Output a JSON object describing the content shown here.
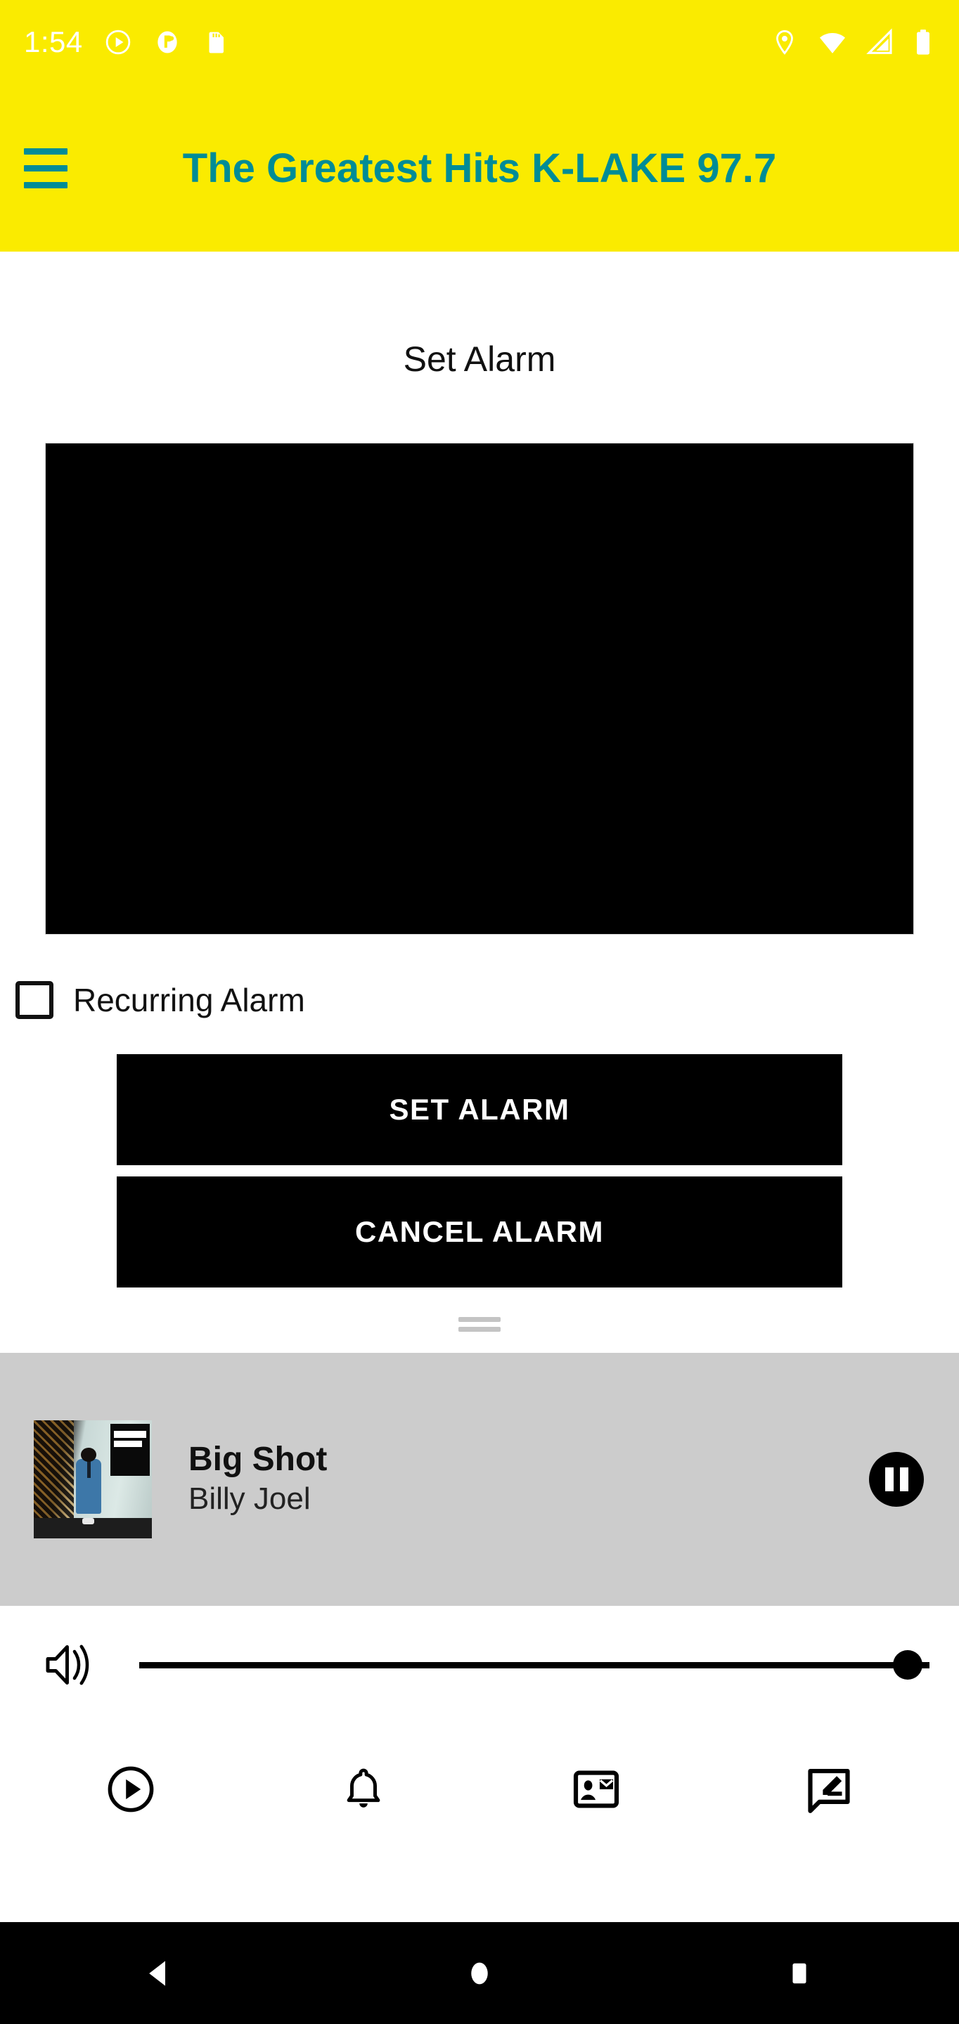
{
  "status_bar": {
    "clock": "1:54",
    "left_icons": [
      "play-circle-notification-icon",
      "app-notification-icon",
      "sd-card-icon"
    ],
    "right_icons": [
      "location-pin-icon",
      "wifi-icon",
      "cellular-signal-icon",
      "battery-icon"
    ]
  },
  "app_bar": {
    "menu_icon": "hamburger-menu-icon",
    "title": "The Greatest Hits K-LAKE 97.7",
    "background_color": "#FAEB00",
    "title_color": "#008C96"
  },
  "main": {
    "screen_title": "Set Alarm",
    "time_picker": {
      "name": "time-picker",
      "state": "blank",
      "background_color": "#000000"
    },
    "recurring": {
      "label": "Recurring Alarm",
      "checked": false
    },
    "buttons": [
      {
        "label": "SET ALARM",
        "name": "set-alarm-button"
      },
      {
        "label": "CANCEL ALARM",
        "name": "cancel-alarm-button"
      }
    ]
  },
  "now_playing": {
    "drag_handle": "drag-handle",
    "album_art_alt": "Billy Joel 52nd Street album cover",
    "title": "Big Shot",
    "artist": "Billy Joel",
    "transport_button": "pause-icon",
    "playing": true,
    "background_color": "#CCCCCC"
  },
  "volume": {
    "icon": "volume-up-icon",
    "level_percent": 100
  },
  "bottom_nav": [
    {
      "name": "tab-play",
      "icon": "play-circle-outline-icon"
    },
    {
      "name": "tab-alarm",
      "icon": "bell-icon"
    },
    {
      "name": "tab-contact",
      "icon": "contact-mail-icon"
    },
    {
      "name": "tab-feedback",
      "icon": "rate-review-icon"
    }
  ],
  "android_nav": [
    {
      "name": "back-button",
      "icon": "triangle-back-icon"
    },
    {
      "name": "home-button",
      "icon": "circle-home-icon"
    },
    {
      "name": "recents-button",
      "icon": "square-recents-icon"
    }
  ]
}
